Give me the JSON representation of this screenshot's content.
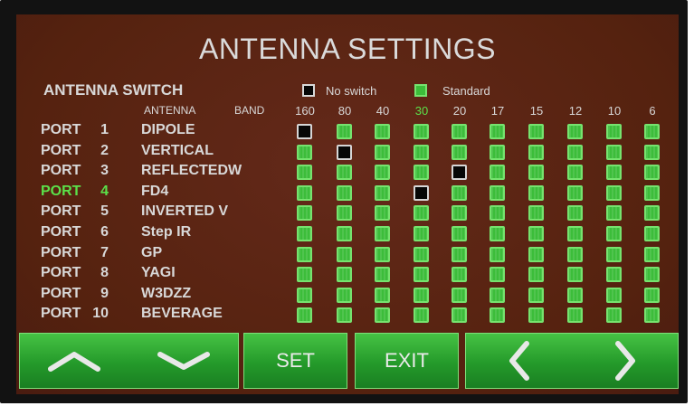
{
  "screen": {
    "title": "ANTENNA SETTINGS"
  },
  "switch": {
    "heading": "ANTENNA SWITCH",
    "legend": [
      {
        "label": "No switch",
        "state": "no-switch"
      },
      {
        "label": "Standard",
        "state": "standard"
      }
    ],
    "antenna_label": "ANTENNA",
    "band_label": "BAND",
    "bands": [
      "160",
      "80",
      "40",
      "30",
      "20",
      "17",
      "15",
      "12",
      "10",
      "6"
    ],
    "highlight_band_index": 3,
    "highlight_color": "#5be14a",
    "rows": [
      {
        "port_label": "PORT",
        "port": "1",
        "antenna": "DIPOLE",
        "noswitch": [
          0
        ]
      },
      {
        "port_label": "PORT",
        "port": "2",
        "antenna": "VERTICAL",
        "noswitch": [
          1
        ]
      },
      {
        "port_label": "PORT",
        "port": "3",
        "antenna": "REFLECTEDW",
        "noswitch": [
          4
        ]
      },
      {
        "port_label": "PORT",
        "port": "4",
        "antenna": "FD4",
        "noswitch": [
          3
        ],
        "selected": true
      },
      {
        "port_label": "PORT",
        "port": "5",
        "antenna": "INVERTED V",
        "noswitch": []
      },
      {
        "port_label": "PORT",
        "port": "6",
        "antenna": "Step IR",
        "noswitch": []
      },
      {
        "port_label": "PORT",
        "port": "7",
        "antenna": "GP",
        "noswitch": []
      },
      {
        "port_label": "PORT",
        "port": "8",
        "antenna": "YAGI",
        "noswitch": []
      },
      {
        "port_label": "PORT",
        "port": "9",
        "antenna": "W3DZZ",
        "noswitch": []
      },
      {
        "port_label": "PORT",
        "port": "10",
        "antenna": "BEVERAGE",
        "noswitch": []
      }
    ]
  },
  "buttons": {
    "up_icon": "chevron-up-icon",
    "down_icon": "chevron-down-icon",
    "set_label": "SET",
    "exit_label": "EXIT",
    "prev_icon": "chevron-left-icon",
    "next_icon": "chevron-right-icon"
  },
  "colors": {
    "background": "#572316",
    "button_green": "#2fae33",
    "cell_green": "#3cbd3a"
  }
}
